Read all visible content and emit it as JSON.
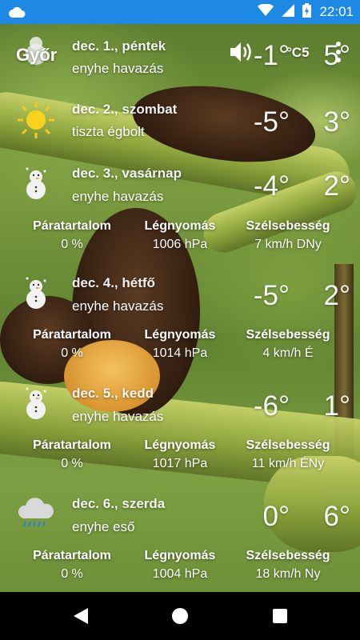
{
  "status_bar": {
    "time": "22:01",
    "icons": [
      "cloud-notification-icon",
      "wifi-icon",
      "signal-icon",
      "battery-charging-icon"
    ]
  },
  "app": {
    "city": "Győr",
    "unit_label": "°C5",
    "icons": [
      "speaker-icon",
      "overflow-menu-icon"
    ]
  },
  "labels": {
    "humidity": "Páratartalom",
    "pressure": "Légnyomás",
    "wind": "Szélsebesség"
  },
  "days": [
    {
      "date": "dec. 1., péntek",
      "condition": "enyhe havazás",
      "low": "-1°",
      "high": "5°",
      "icon": "snowman-icon"
    },
    {
      "date": "dec. 2., szombat",
      "condition": "tiszta égbolt",
      "low": "-5°",
      "high": "3°",
      "icon": "sun-icon"
    },
    {
      "date": "dec. 3., vasárnap",
      "condition": "enyhe havazás",
      "low": "-4°",
      "high": "2°",
      "icon": "snowman-icon",
      "humidity": "0 %",
      "pressure": "1006 hPa",
      "wind": "7 km/h DNy"
    },
    {
      "date": "dec. 4., hétfő",
      "condition": "enyhe havazás",
      "low": "-5°",
      "high": "2°",
      "icon": "snowman-icon",
      "humidity": "0 %",
      "pressure": "1014 hPa",
      "wind": "4 km/h É"
    },
    {
      "date": "dec. 5., kedd",
      "condition": "enyhe havazás",
      "low": "-6°",
      "high": "1°",
      "icon": "snowman-icon",
      "humidity": "0 %",
      "pressure": "1017 hPa",
      "wind": "11 km/h ÉNy"
    },
    {
      "date": "dec. 6., szerda",
      "condition": "enyhe eső",
      "low": "0°",
      "high": "6°",
      "icon": "rain-cloud-icon",
      "humidity": "0 %",
      "pressure": "1004 hPa",
      "wind": "18 km/h Ny"
    }
  ],
  "nav": {
    "icons": [
      "back-icon",
      "home-icon",
      "recents-icon"
    ]
  },
  "colors": {
    "status_bar": "#1e88e5",
    "nav_bar": "#000000",
    "text": "#ffffff"
  }
}
